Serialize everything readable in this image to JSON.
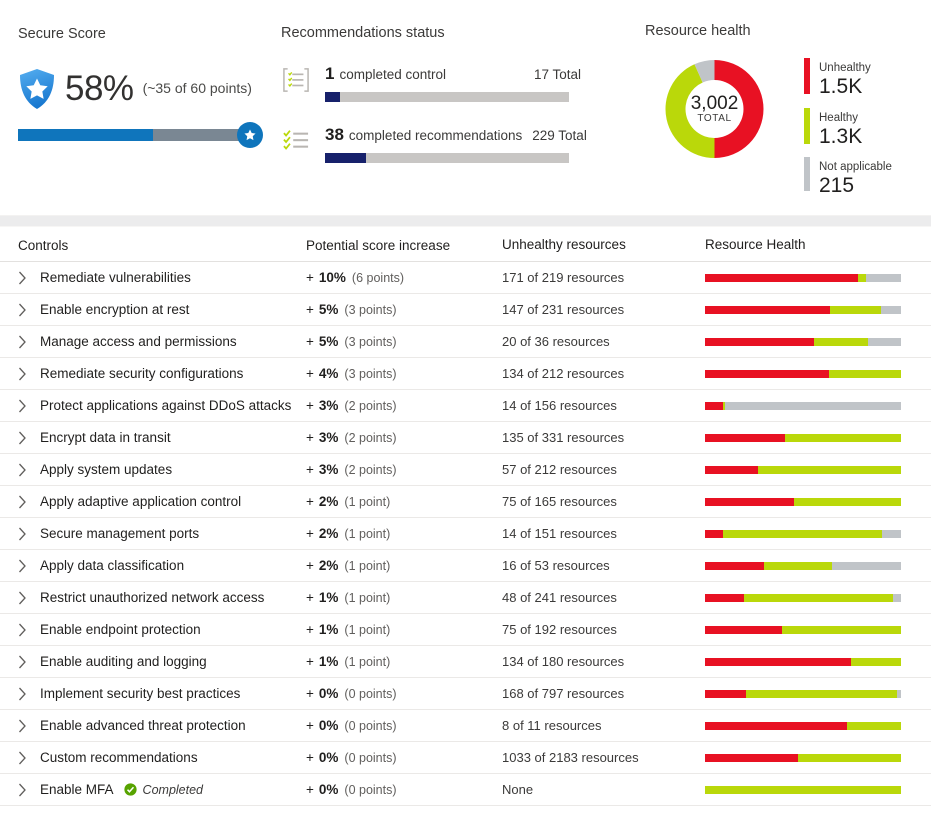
{
  "colors": {
    "unhealthy": "#e81123",
    "healthy": "#bad80a",
    "not_applicable": "#c0c4c8",
    "accent_blue": "#0f75bc",
    "navy": "#17216b",
    "track_gray": "#c8c6c4",
    "score_track": "#7a8793",
    "completed_green": "#57a300"
  },
  "secure_score": {
    "title": "Secure Score",
    "percent": "58%",
    "points_text": "(~35 of 60 points)",
    "fill_pct": 58,
    "shield_icon": "shield-star-icon",
    "badge_icon": "star-badge-icon"
  },
  "recommendations_status": {
    "title": "Recommendations status",
    "items": [
      {
        "icon": "controls-list-icon",
        "count": "1",
        "label": "completed control",
        "total": "17 Total",
        "fill_pct": 6
      },
      {
        "icon": "checklist-icon",
        "count": "38",
        "label": "completed recommendations",
        "total": "229 Total",
        "fill_pct": 17
      }
    ]
  },
  "resource_health": {
    "title": "Resource health",
    "donut": {
      "total": "3,002",
      "total_label": "TOTAL",
      "segments": [
        {
          "name": "Unhealthy",
          "value": 1500,
          "pct": 50.0,
          "color": "#e81123"
        },
        {
          "name": "Healthy",
          "value": 1300,
          "pct": 43.3,
          "color": "#bad80a"
        },
        {
          "name": "Not applicable",
          "value": 215,
          "pct": 6.7,
          "color": "#c0c4c8"
        }
      ]
    },
    "legend": [
      {
        "name": "Unhealthy",
        "value": "1.5K",
        "color": "#e81123"
      },
      {
        "name": "Healthy",
        "value": "1.3K",
        "color": "#bad80a"
      },
      {
        "name": "Not applicable",
        "value": "215",
        "color": "#c0c4c8"
      }
    ]
  },
  "table": {
    "headers": {
      "controls": "Controls",
      "potential": "Potential score increase",
      "unhealthy": "Unhealthy resources",
      "health": "Resource Health"
    },
    "rows": [
      {
        "name": "Remediate vulnerabilities",
        "plus": "+",
        "pct": "10%",
        "points": "(6 points)",
        "unhealthy": "171 of 219 resources",
        "bar": {
          "unhealthy": 78.1,
          "healthy": 4.1,
          "not_applicable": 17.8
        }
      },
      {
        "name": "Enable encryption at rest",
        "plus": "+",
        "pct": "5%",
        "points": "(3 points)",
        "unhealthy": "147 of 231 resources",
        "bar": {
          "unhealthy": 63.6,
          "healthy": 26.0,
          "not_applicable": 10.4
        }
      },
      {
        "name": "Manage access and permissions",
        "plus": "+",
        "pct": "5%",
        "points": "(3 points)",
        "unhealthy": "20 of 36 resources",
        "bar": {
          "unhealthy": 55.6,
          "healthy": 27.8,
          "not_applicable": 16.6
        }
      },
      {
        "name": "Remediate security configurations",
        "plus": "+",
        "pct": "4%",
        "points": "(3 points)",
        "unhealthy": "134 of 212 resources",
        "bar": {
          "unhealthy": 63.2,
          "healthy": 36.8,
          "not_applicable": 0
        }
      },
      {
        "name": "Protect applications against DDoS attacks",
        "plus": "+",
        "pct": "3%",
        "points": "(2 points)",
        "unhealthy": "14 of 156 resources",
        "bar": {
          "unhealthy": 9.0,
          "healthy": 1.0,
          "not_applicable": 90.0
        }
      },
      {
        "name": "Encrypt data in transit",
        "plus": "+",
        "pct": "3%",
        "points": "(2 points)",
        "unhealthy": "135 of 331 resources",
        "bar": {
          "unhealthy": 40.8,
          "healthy": 59.2,
          "not_applicable": 0
        }
      },
      {
        "name": "Apply system updates",
        "plus": "+",
        "pct": "3%",
        "points": "(2 points)",
        "unhealthy": "57 of 212 resources",
        "bar": {
          "unhealthy": 26.9,
          "healthy": 73.1,
          "not_applicable": 0
        }
      },
      {
        "name": "Apply adaptive application control",
        "plus": "+",
        "pct": "2%",
        "points": "(1 point)",
        "unhealthy": "75 of 165 resources",
        "bar": {
          "unhealthy": 45.5,
          "healthy": 54.5,
          "not_applicable": 0
        }
      },
      {
        "name": "Secure management ports",
        "plus": "+",
        "pct": "2%",
        "points": "(1 point)",
        "unhealthy": "14 of 151 resources",
        "bar": {
          "unhealthy": 9.3,
          "healthy": 81.0,
          "not_applicable": 9.7
        }
      },
      {
        "name": "Apply data classification",
        "plus": "+",
        "pct": "2%",
        "points": "(1 point)",
        "unhealthy": "16 of 53 resources",
        "bar": {
          "unhealthy": 30.2,
          "healthy": 34.8,
          "not_applicable": 35.0
        }
      },
      {
        "name": "Restrict unauthorized network access",
        "plus": "+",
        "pct": "1%",
        "points": "(1 point)",
        "unhealthy": "48 of 241 resources",
        "bar": {
          "unhealthy": 19.9,
          "healthy": 76.1,
          "not_applicable": 4.0
        }
      },
      {
        "name": "Enable endpoint protection",
        "plus": "+",
        "pct": "1%",
        "points": "(1 point)",
        "unhealthy": "75 of 192 resources",
        "bar": {
          "unhealthy": 39.1,
          "healthy": 60.9,
          "not_applicable": 0
        }
      },
      {
        "name": "Enable auditing and logging",
        "plus": "+",
        "pct": "1%",
        "points": "(1 point)",
        "unhealthy": "134 of 180 resources",
        "bar": {
          "unhealthy": 74.4,
          "healthy": 25.6,
          "not_applicable": 0
        }
      },
      {
        "name": "Implement security best practices",
        "plus": "+",
        "pct": "0%",
        "points": "(0 points)",
        "unhealthy": "168 of 797 resources",
        "bar": {
          "unhealthy": 21.1,
          "healthy": 76.9,
          "not_applicable": 2.0
        }
      },
      {
        "name": "Enable advanced threat protection",
        "plus": "+",
        "pct": "0%",
        "points": "(0 points)",
        "unhealthy": "8 of 11 resources",
        "bar": {
          "unhealthy": 72.7,
          "healthy": 27.3,
          "not_applicable": 0
        }
      },
      {
        "name": "Custom recommendations",
        "plus": "+",
        "pct": "0%",
        "points": "(0 points)",
        "unhealthy": "1033 of 2183 resources",
        "bar": {
          "unhealthy": 47.3,
          "healthy": 52.7,
          "not_applicable": 0
        }
      },
      {
        "name": "Enable MFA",
        "status": "Completed",
        "plus": "+",
        "pct": "0%",
        "points": "(0 points)",
        "unhealthy": "None",
        "bar": {
          "unhealthy": 0,
          "healthy": 100,
          "not_applicable": 0
        }
      }
    ]
  }
}
